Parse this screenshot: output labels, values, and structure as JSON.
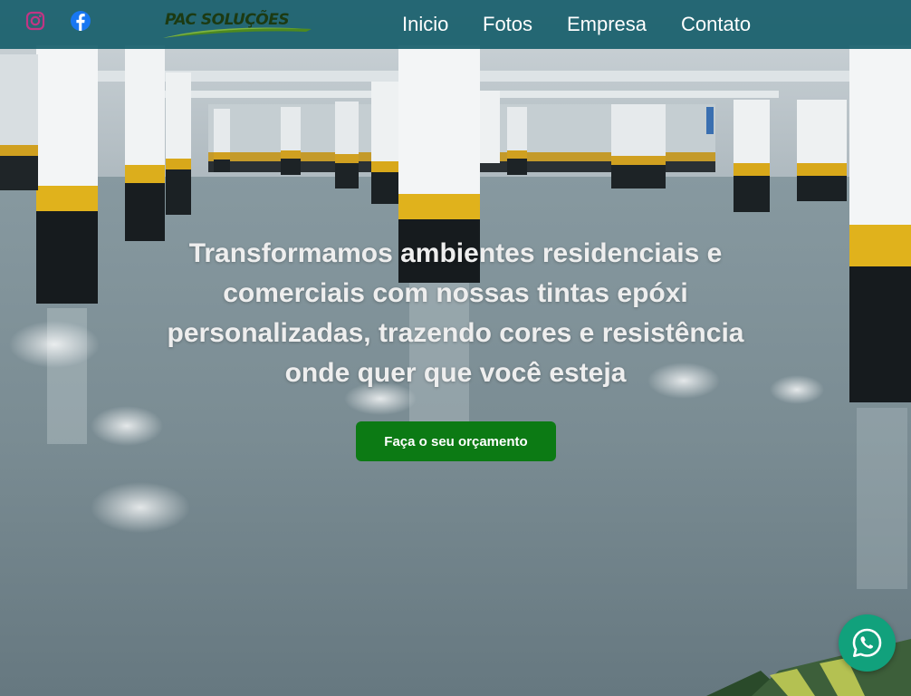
{
  "header": {
    "logo_text": "PAC SOLUÇÕES",
    "social": [
      {
        "icon": "instagram-icon",
        "color": "#c13584"
      },
      {
        "icon": "facebook-icon",
        "color": "#1877f2"
      }
    ],
    "nav": [
      "Inicio",
      "Fotos",
      "Empresa",
      "Contato"
    ],
    "bar_color": "#185f6c"
  },
  "hero": {
    "headline": "Transformamos ambientes residenciais e comerciais com nossas tintas epóxi personalizadas, trazendo cores e resistência onde quer que você esteja",
    "cta_label": "Faça o seu orçamento",
    "cta_color": "#0c7a14",
    "background": "epoxy-painted-parking-garage-photo"
  },
  "floating": {
    "icon": "whatsapp-icon",
    "color": "#11a17c"
  }
}
